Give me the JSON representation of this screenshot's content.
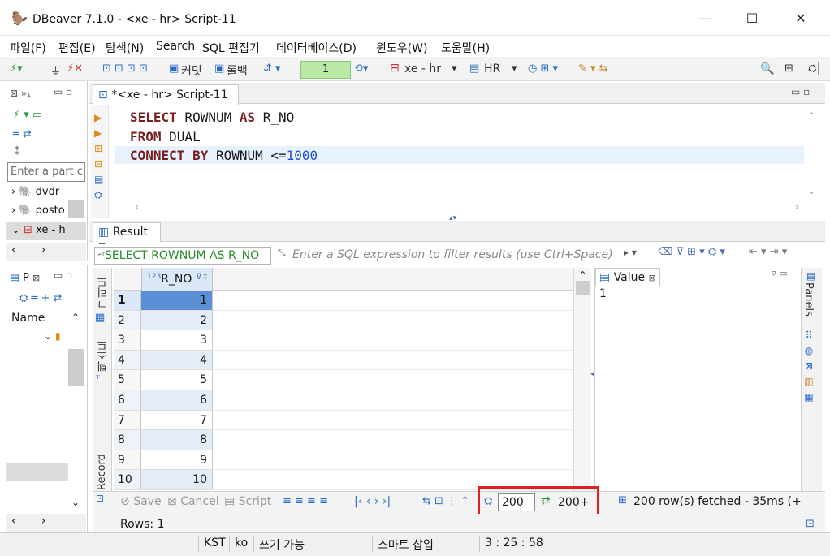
{
  "window": {
    "title": "DBeaver 7.1.0 - <xe - hr> Script-11"
  },
  "menu": [
    "파일(F)",
    "편집(E)",
    "탐색(N)",
    "Search",
    "SQL 편집기",
    "데이터베이스(D)",
    "윈도우(W)",
    "도움말(H)"
  ],
  "toolbar": {
    "commit_label": "커밋",
    "rollback_label": "롤백",
    "txn_count": "1",
    "connection": "xe - hr",
    "schema": "HR"
  },
  "navigator": {
    "filter_placeholder": "Enter a part c",
    "tree": [
      "dvdr",
      "posto",
      "xe - h"
    ]
  },
  "projects": {
    "tab": "P",
    "column": "Name"
  },
  "editor": {
    "tab_label": "*<xe - hr> Script-11",
    "lines": [
      {
        "kw1": "SELECT",
        "t1": " ROWNUM ",
        "kw2": "AS",
        "t2": " R_NO",
        "num": ""
      },
      {
        "kw1": "FROM",
        "t1": " DUAL",
        "kw2": "",
        "t2": "",
        "num": ""
      },
      {
        "kw1": "CONNECT BY",
        "t1": " ROWNUM <=",
        "kw2": "",
        "t2": "",
        "num": "1000"
      }
    ]
  },
  "result": {
    "tab_label": "Result",
    "query_label": "SELECT ROWNUM AS R_NO",
    "filter_placeholder": "Enter a SQL expression to filter results (use Ctrl+Space)",
    "side_grid": "그리드",
    "side_text": "텍스트",
    "side_record": "Record",
    "column": "R_NO",
    "column_type": "123",
    "rows": [
      {
        "n": "1",
        "v": "1"
      },
      {
        "n": "2",
        "v": "2"
      },
      {
        "n": "3",
        "v": "3"
      },
      {
        "n": "4",
        "v": "4"
      },
      {
        "n": "5",
        "v": "5"
      },
      {
        "n": "6",
        "v": "6"
      },
      {
        "n": "7",
        "v": "7"
      },
      {
        "n": "8",
        "v": "8"
      },
      {
        "n": "9",
        "v": "9"
      },
      {
        "n": "10",
        "v": "10"
      }
    ],
    "value_tab": "Value",
    "value": "1",
    "panels_label": "Panels",
    "save": "Save",
    "cancel": "Cancel",
    "script": "Script",
    "fetch_size": "200",
    "fetch_more": "200+",
    "fetched_status": "200 row(s) fetched - 35ms (+",
    "rows_status": "Rows: 1"
  },
  "statusbar": {
    "timezone": "KST",
    "locale": "ko",
    "writable": "쓰기 가능",
    "insert_mode": "스마트 삽입",
    "position": "3 : 25 : 58"
  }
}
